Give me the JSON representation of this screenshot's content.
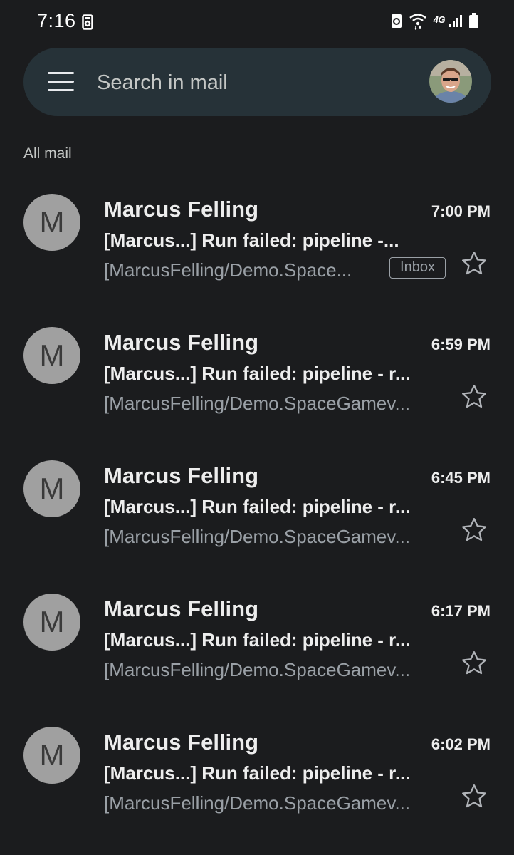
{
  "status_bar": {
    "time": "7:16",
    "network": "4G"
  },
  "search": {
    "placeholder": "Search in mail"
  },
  "section_label": "All mail",
  "emails": [
    {
      "avatar_letter": "M",
      "sender": "Marcus Felling",
      "time": "7:00 PM",
      "subject": "[Marcus...] Run failed: pipeline -...",
      "preview": "[MarcusFelling/Demo.Space...",
      "label": "Inbox",
      "starred": false
    },
    {
      "avatar_letter": "M",
      "sender": "Marcus Felling",
      "time": "6:59 PM",
      "subject": "[Marcus...] Run failed: pipeline - r...",
      "preview": "[MarcusFelling/Demo.SpaceGamev...",
      "starred": false
    },
    {
      "avatar_letter": "M",
      "sender": "Marcus Felling",
      "time": "6:45 PM",
      "subject": "[Marcus...] Run failed: pipeline - r...",
      "preview": "[MarcusFelling/Demo.SpaceGamev...",
      "starred": false
    },
    {
      "avatar_letter": "M",
      "sender": "Marcus Felling",
      "time": "6:17 PM",
      "subject": "[Marcus...] Run failed: pipeline - r...",
      "preview": "[MarcusFelling/Demo.SpaceGamev...",
      "starred": false
    },
    {
      "avatar_letter": "M",
      "sender": "Marcus Felling",
      "time": "6:02 PM",
      "subject": "[Marcus...] Run failed: pipeline - r...",
      "preview": "[MarcusFelling/Demo.SpaceGamev...",
      "starred": false
    }
  ],
  "icons": {
    "menu": "hamburger-menu-icon",
    "star": "star-outline-icon",
    "wifi": "wifi-icon",
    "signal": "cellular-signal-icon",
    "battery": "battery-icon"
  },
  "colors": {
    "background": "#1b1c1e",
    "search_bar": "#263238",
    "avatar_bg": "#a0a0a0",
    "primary_text": "#ededed",
    "secondary_text": "#9aa0a6"
  }
}
